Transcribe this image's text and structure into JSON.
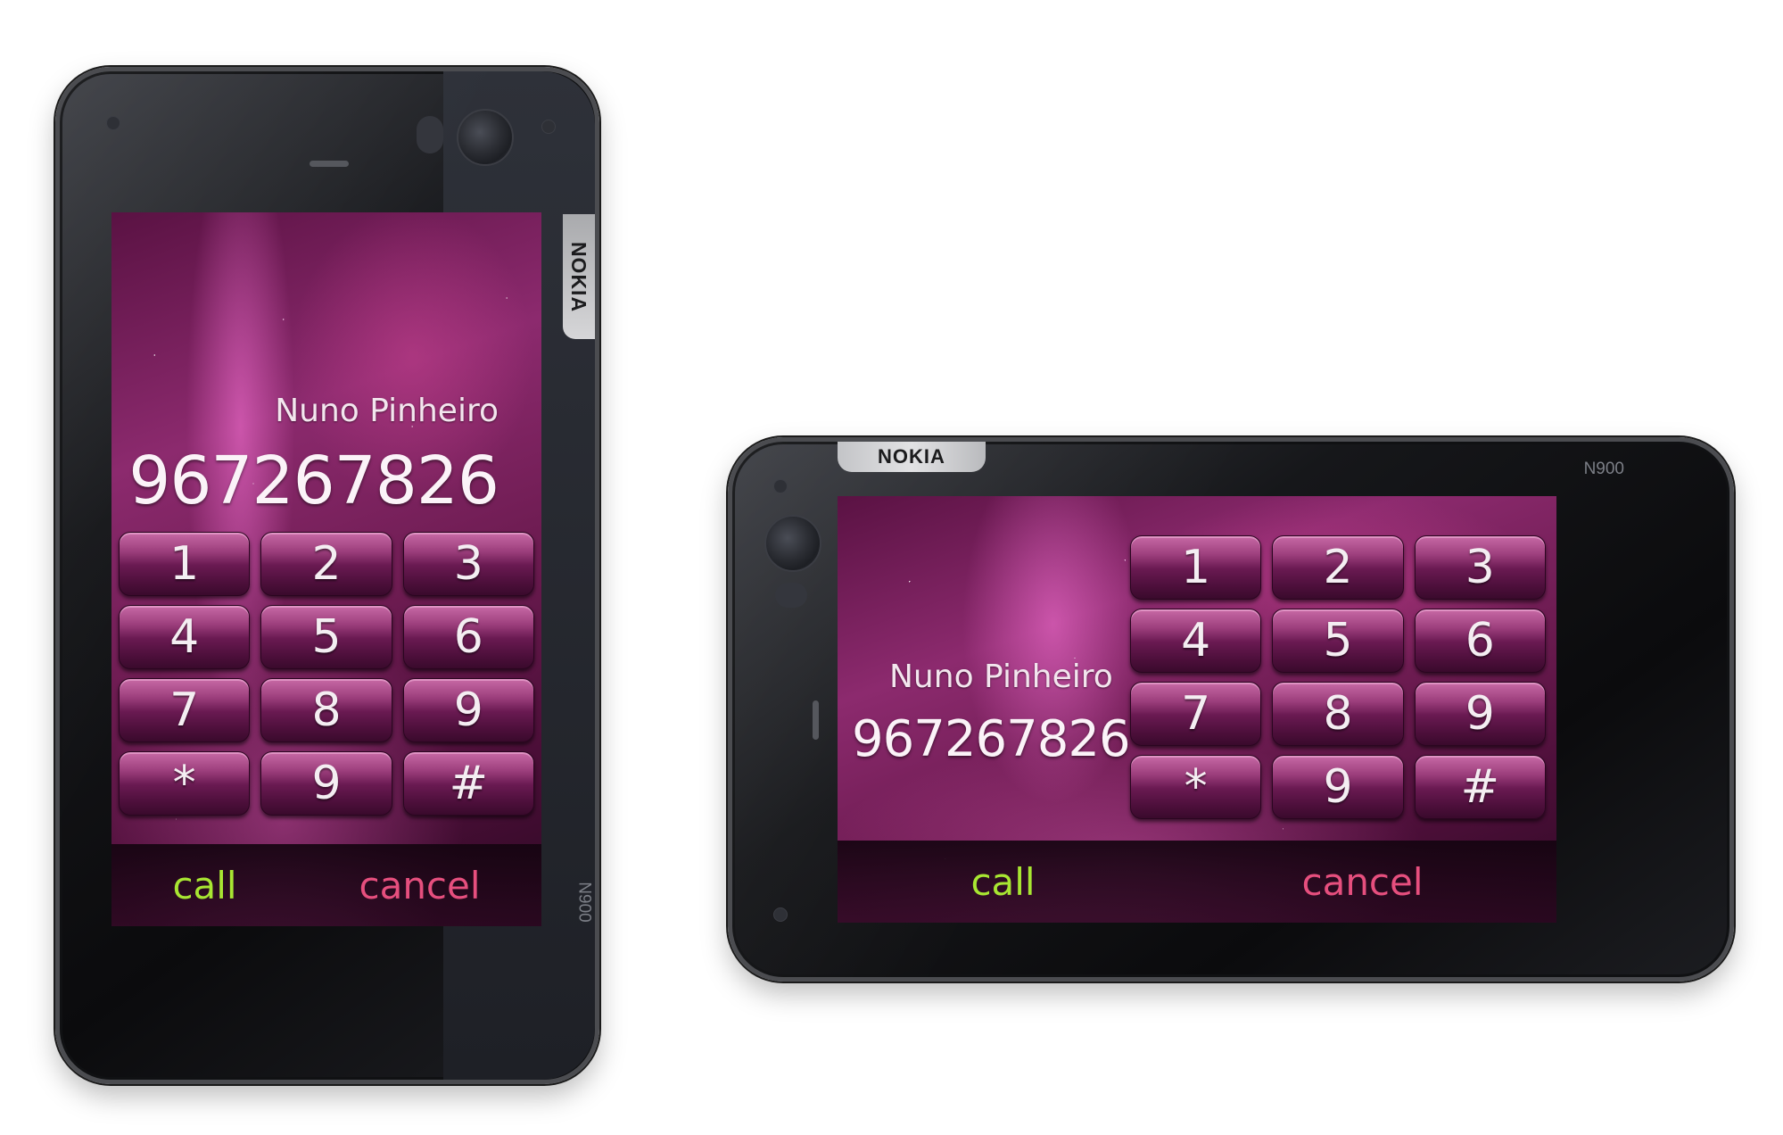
{
  "brand": "NOKIA",
  "model": "N900",
  "contact": {
    "name": "Nuno Pinheiro",
    "number": "967267826"
  },
  "keypad": {
    "keys": [
      "1",
      "2",
      "3",
      "4",
      "5",
      "6",
      "7",
      "8",
      "9",
      "*",
      "9",
      "#"
    ]
  },
  "actions": {
    "call_label": "call",
    "cancel_label": "cancel"
  },
  "colors": {
    "call": "#a8e632",
    "cancel": "#e64f7e",
    "key_fill": "#7a2460",
    "wallpaper": "#8c2a6e"
  }
}
